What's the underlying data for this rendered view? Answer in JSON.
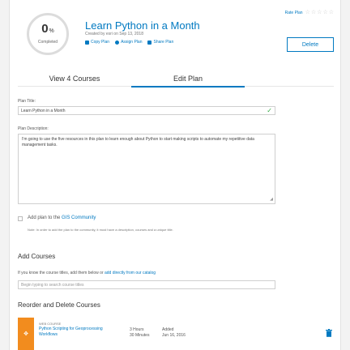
{
  "header": {
    "progress_value": "0",
    "progress_unit": "%",
    "progress_fraction": 0,
    "progress_caption": "Completed",
    "plan_title": "Learn Python in a Month",
    "created_by": "Created by esri on Sep 13, 2018",
    "actions": [
      {
        "label": "Copy Plan",
        "icon": "copy-icon"
      },
      {
        "label": "Assign Plan",
        "icon": "assign-icon"
      },
      {
        "label": "Share Plan",
        "icon": "share-icon"
      }
    ],
    "rate_label": "Rate Plan",
    "rating": 0,
    "delete_label": "Delete"
  },
  "tabs": [
    {
      "label": "View 4 Courses",
      "active": false
    },
    {
      "label": "Edit Plan",
      "active": true
    }
  ],
  "form": {
    "title_label": "Plan Title:",
    "title_value": "Learn Python in a Month",
    "description_label": "Plan Description:",
    "description_value": "I'm going to use the five resources in this plan to learn enough about Python to start making scripts to automate my repetitive data management tasks.",
    "community_prefix": "Add plan to the ",
    "community_link": "GIS Community",
    "community_note": "Note: In order to add the plan to the community, it must have a description, courses and a unique title."
  },
  "add_courses": {
    "heading": "Add Courses",
    "help_prefix": "If you know the course titles, add them below or ",
    "help_link": "add directly from our catalog",
    "search_placeholder": "Begin typing to search course titles"
  },
  "reorder": {
    "heading": "Reorder and Delete Courses",
    "courses": [
      {
        "type": "WEB COURSE",
        "title": "Python Scripting for Geoprocessing Workflows",
        "duration_line1": "3 Hours",
        "duration_line2": "30 Minutes",
        "added_line1": "Added",
        "added_line2": "Jun 16, 2016"
      }
    ]
  },
  "colors": {
    "accent": "#0079c1",
    "drag_handle": "#f28c1e",
    "valid_check": "#35ac46"
  }
}
